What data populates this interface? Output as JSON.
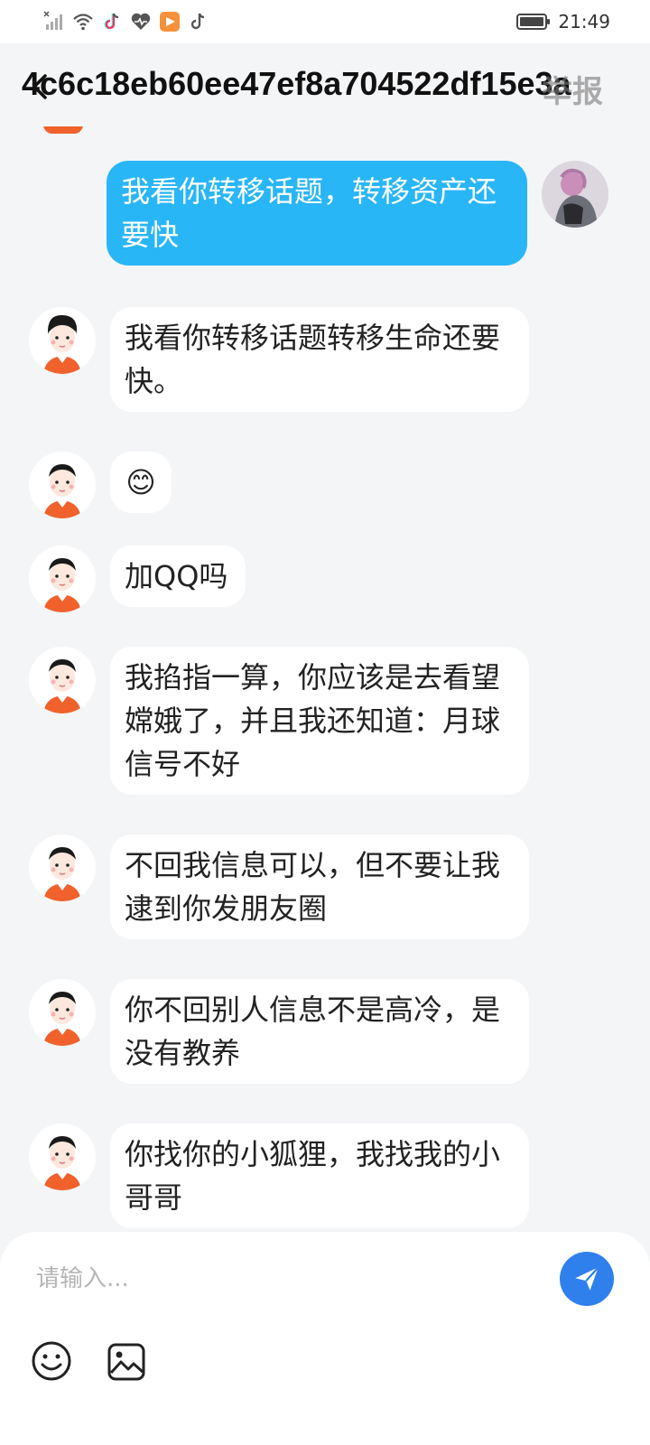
{
  "status_bar": {
    "time": "21:49",
    "icons": [
      "signal-off-icon",
      "wifi-icon",
      "tiktok-icon",
      "health-icon",
      "video-app-icon",
      "tiktok-icon",
      "battery-icon"
    ]
  },
  "header": {
    "title": "4c6c18eb60ee47ef8a704522df15e3a",
    "report_label": "举报"
  },
  "messages": [
    {
      "sender": "me",
      "text": "我看你转移话题，转移资产还要快"
    },
    {
      "sender": "other",
      "text": "我看你转移话题转移生命还要快。"
    },
    {
      "sender": "other",
      "text": "😊"
    },
    {
      "sender": "other",
      "text": "加QQ吗"
    },
    {
      "sender": "other",
      "text": "我掐指一算，你应该是去看望嫦娥了，并且我还知道：月球信号不好"
    },
    {
      "sender": "other",
      "text": "不回我信息可以，但不要让我逮到你发朋友圈"
    },
    {
      "sender": "other",
      "text": "你不回别人信息不是高冷，是没有教养"
    },
    {
      "sender": "other",
      "text": "你找你的小狐狸，我找我的小哥哥"
    }
  ],
  "composer": {
    "placeholder": "请输入...",
    "send_icon": "send-icon",
    "emoji_icon": "emoji-icon",
    "image_icon": "image-icon"
  },
  "colors": {
    "outgoing_bubble": "#29b6f6",
    "send_button": "#2f80ed",
    "avatar_shirt": "#f0612c"
  }
}
